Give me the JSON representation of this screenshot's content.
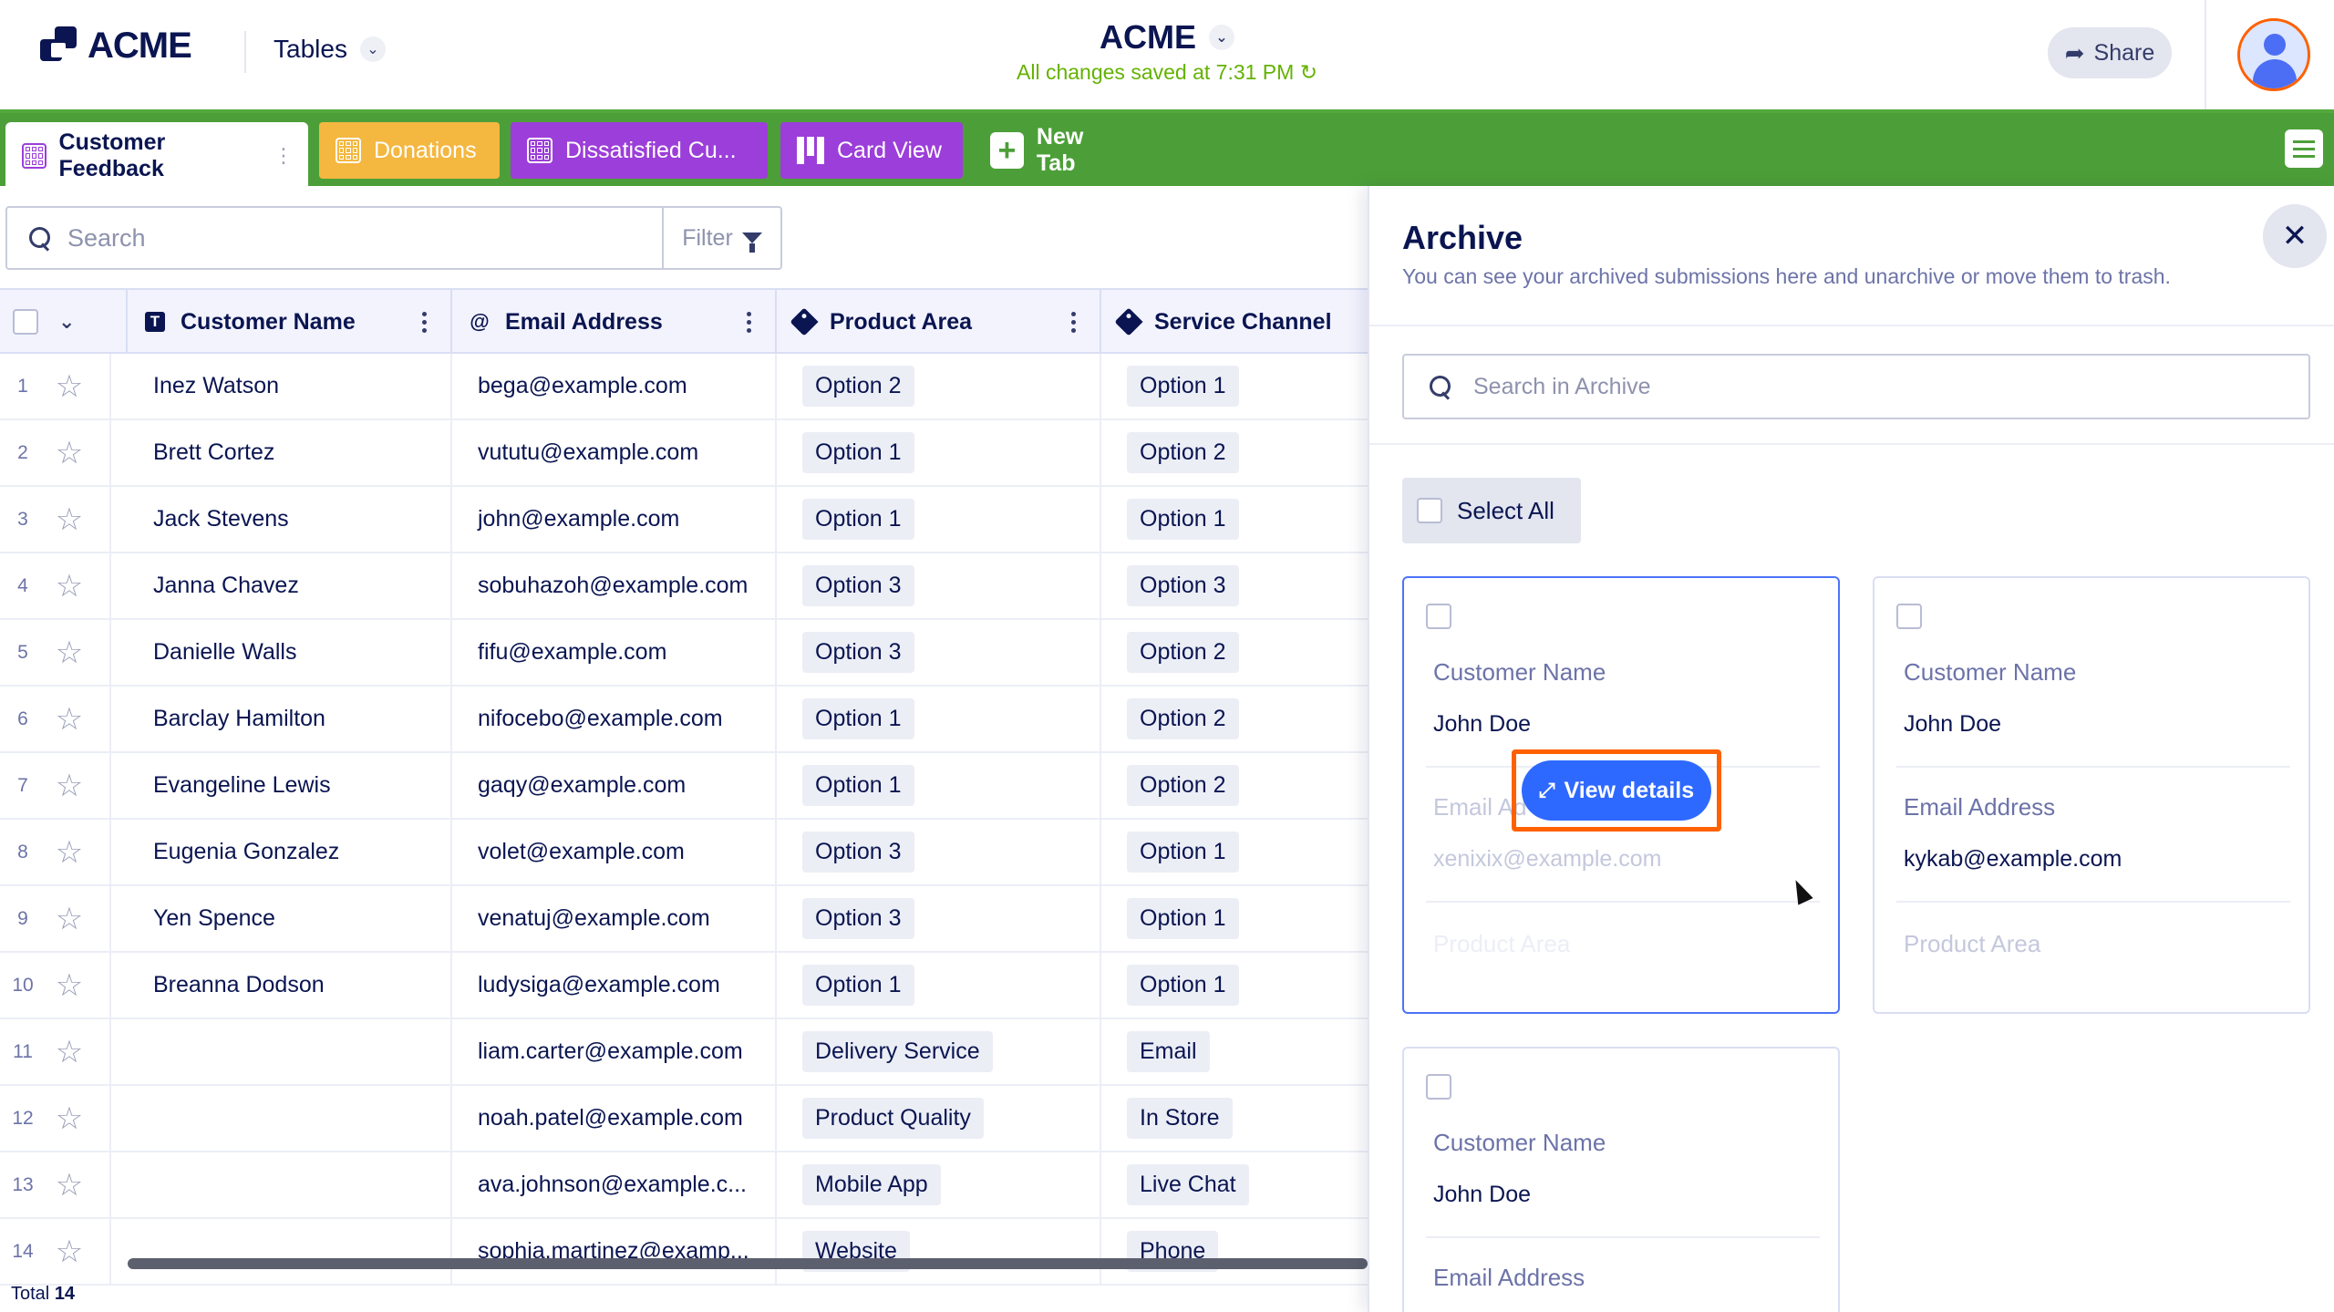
{
  "header": {
    "logo_text": "ACME",
    "tables_label": "Tables",
    "app_title": "ACME",
    "save_status": "All changes saved at 7:31 PM",
    "share_label": "Share"
  },
  "tabs": [
    {
      "label": "Customer Feedback",
      "color": "#ffffff"
    },
    {
      "label": "Donations",
      "color": "#f4b740"
    },
    {
      "label": "Dissatisfied Cu...",
      "color": "#9c3ed9"
    },
    {
      "label": "Card View",
      "color": "#9c3ed9"
    },
    {
      "label": "New Tab",
      "color": "#4c9f38"
    }
  ],
  "toolbar": {
    "search_placeholder": "Search",
    "filter_label": "Filter"
  },
  "table": {
    "columns": [
      "Customer Name",
      "Email Address",
      "Product Area",
      "Service Channel"
    ],
    "rows": [
      {
        "num": "1",
        "name": "Inez Watson",
        "email": "bega@example.com",
        "product": "Option 2",
        "channel": "Option 1"
      },
      {
        "num": "2",
        "name": "Brett Cortez",
        "email": "vututu@example.com",
        "product": "Option 1",
        "channel": "Option 2"
      },
      {
        "num": "3",
        "name": "Jack Stevens",
        "email": "john@example.com",
        "product": "Option 1",
        "channel": "Option 1"
      },
      {
        "num": "4",
        "name": "Janna Chavez",
        "email": "sobuhazoh@example.com",
        "product": "Option 3",
        "channel": "Option 3"
      },
      {
        "num": "5",
        "name": "Danielle Walls",
        "email": "fifu@example.com",
        "product": "Option 3",
        "channel": "Option 2"
      },
      {
        "num": "6",
        "name": "Barclay Hamilton",
        "email": "nifocebo@example.com",
        "product": "Option 1",
        "channel": "Option 2"
      },
      {
        "num": "7",
        "name": "Evangeline Lewis",
        "email": "gaqy@example.com",
        "product": "Option 1",
        "channel": "Option 2"
      },
      {
        "num": "8",
        "name": "Eugenia Gonzalez",
        "email": "volet@example.com",
        "product": "Option 3",
        "channel": "Option 1"
      },
      {
        "num": "9",
        "name": "Yen Spence",
        "email": "venatuj@example.com",
        "product": "Option 3",
        "channel": "Option 1"
      },
      {
        "num": "10",
        "name": "Breanna Dodson",
        "email": "ludysiga@example.com",
        "product": "Option 1",
        "channel": "Option 1"
      },
      {
        "num": "11",
        "name": "",
        "email": "liam.carter@example.com",
        "product": "Delivery Service",
        "channel": "Email"
      },
      {
        "num": "12",
        "name": "",
        "email": "noah.patel@example.com",
        "product": "Product Quality",
        "channel": "In Store"
      },
      {
        "num": "13",
        "name": "",
        "email": "ava.johnson@example.c...",
        "product": "Mobile App",
        "channel": "Live Chat"
      },
      {
        "num": "14",
        "name": "",
        "email": "sophia.martinez@examp...",
        "product": "Website",
        "channel": "Phone"
      }
    ],
    "total_label": "Total",
    "total_count": "14"
  },
  "archive": {
    "title": "Archive",
    "description": "You can see your archived submissions here and unarchive or move them to trash.",
    "search_placeholder": "Search in Archive",
    "select_all_label": "Select All",
    "view_details_label": "View details",
    "cards": [
      {
        "name_label": "Customer Name",
        "name": "John Doe",
        "email_label": "Email Ad",
        "email": "xenixix@example.com",
        "product_label": "Product Area"
      },
      {
        "name_label": "Customer Name",
        "name": "John Doe",
        "email_label": "Email Address",
        "email": "kykab@example.com",
        "product_label": "Product Area"
      },
      {
        "name_label": "Customer Name",
        "name": "John Doe",
        "email_label": "Email Address"
      }
    ]
  }
}
